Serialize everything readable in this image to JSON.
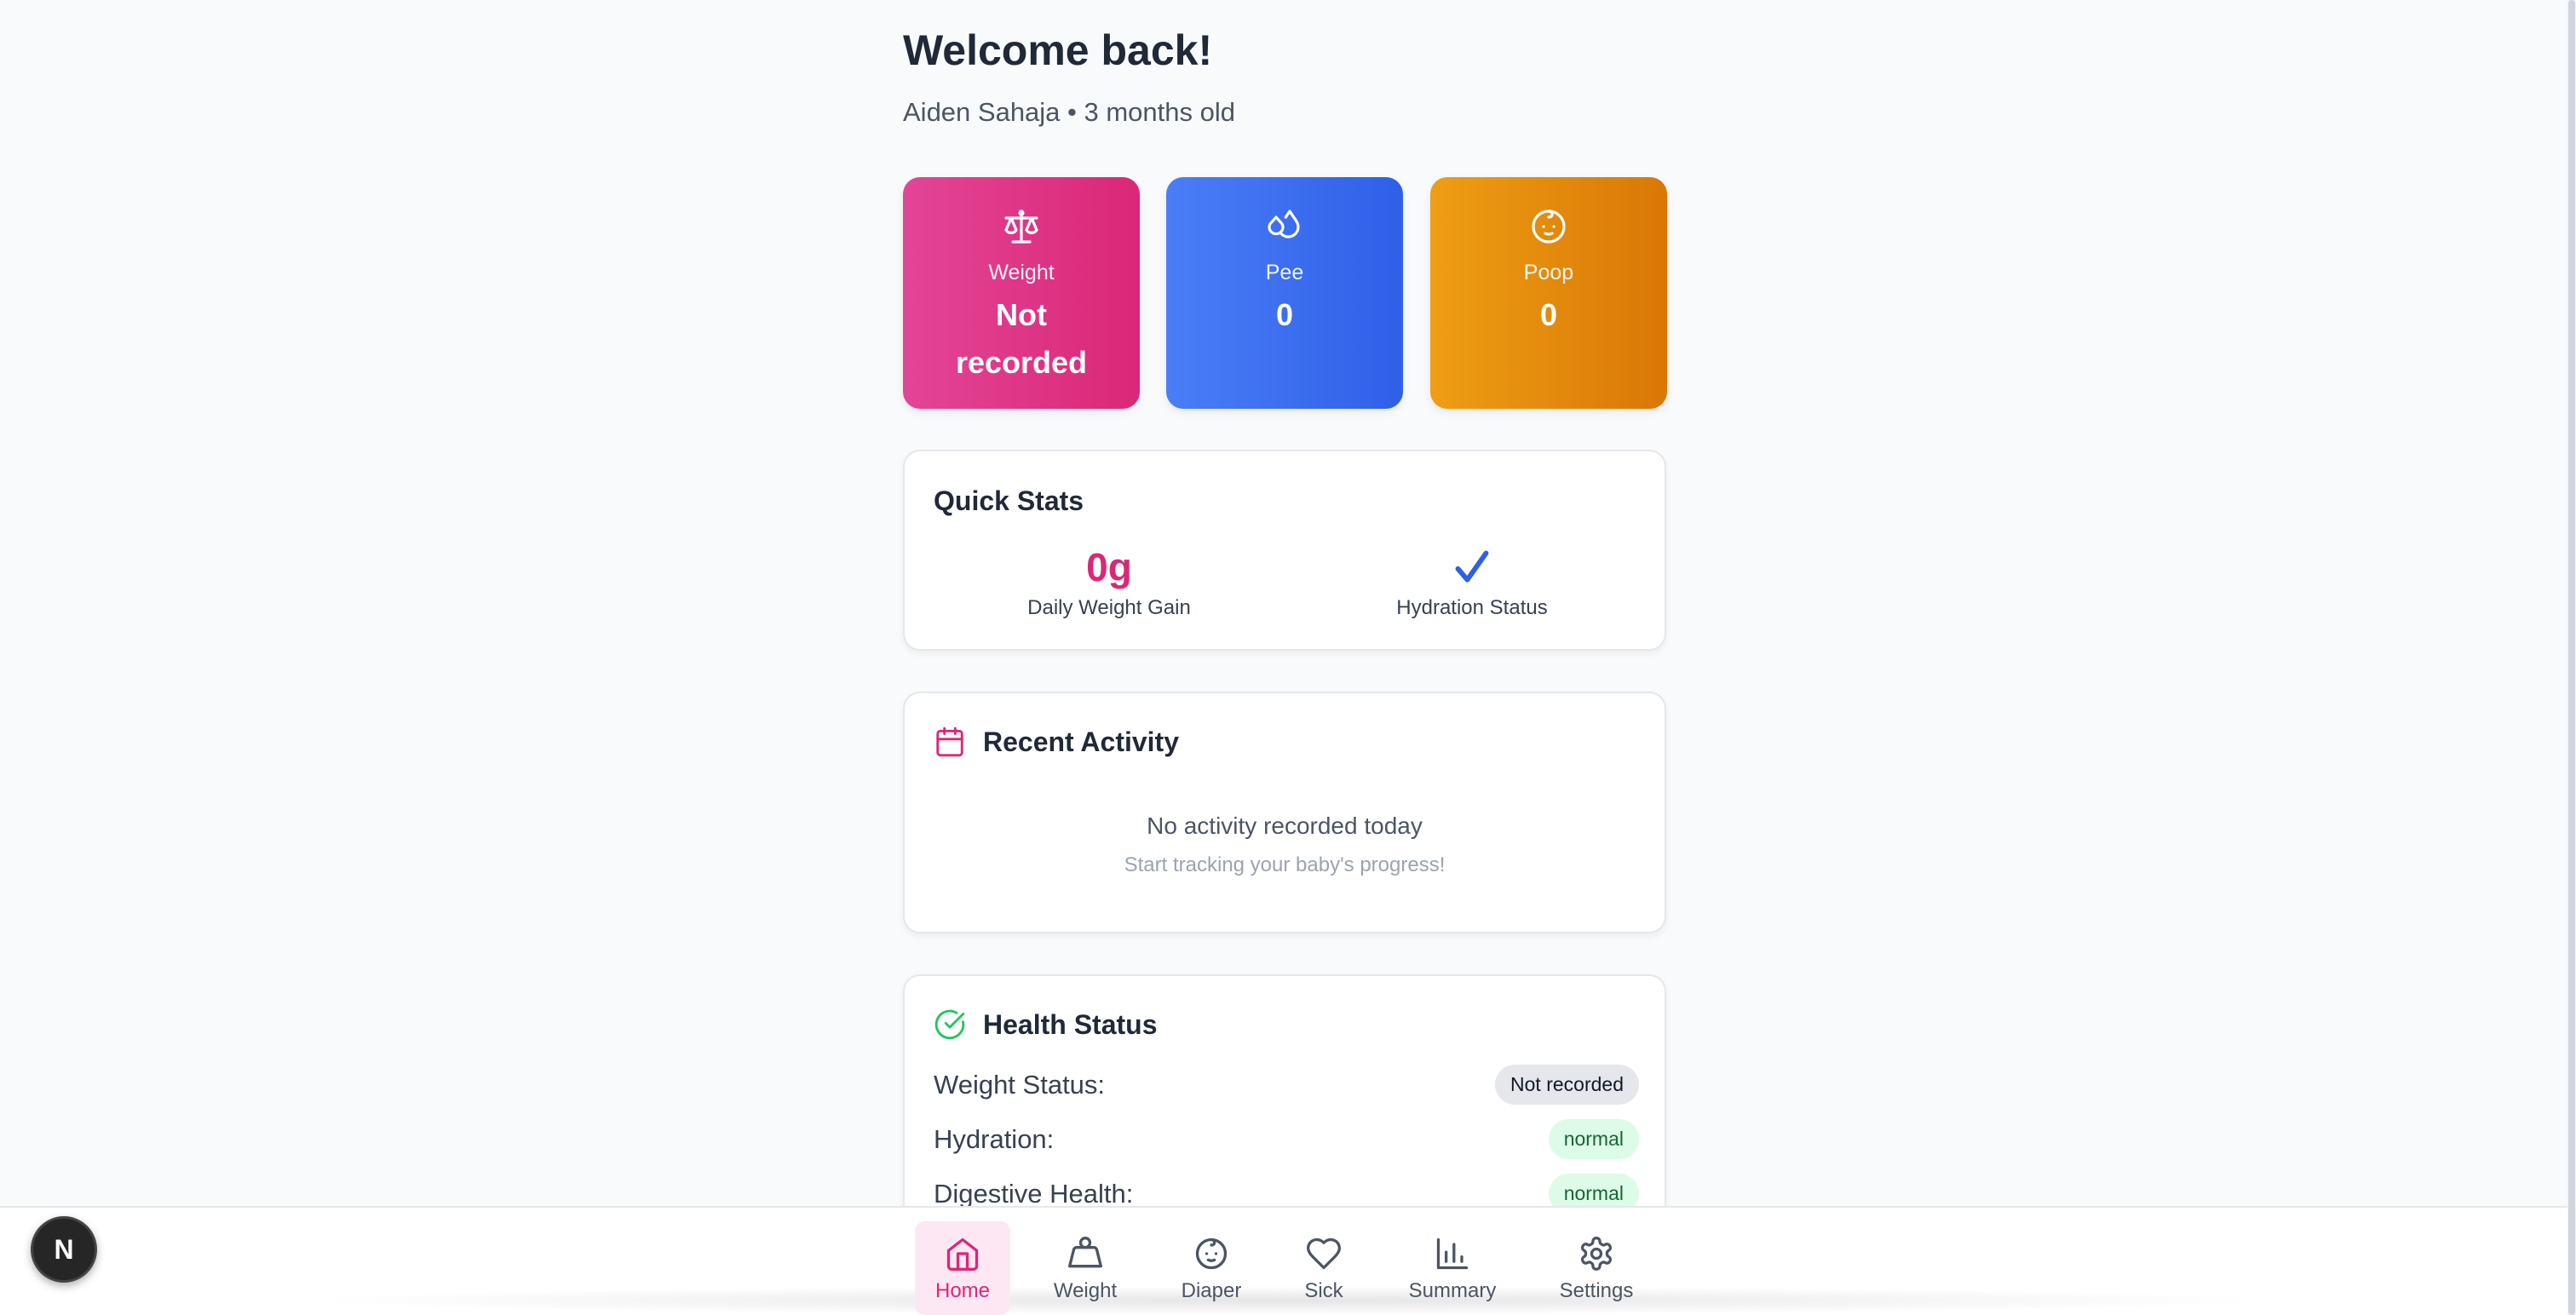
{
  "header": {
    "title": "Welcome back!",
    "subtitle": "Aiden Sahaja • 3 months old"
  },
  "tiles": [
    {
      "label": "Weight",
      "value": "Not recorded",
      "icon": "scale-icon",
      "color": "#db2777"
    },
    {
      "label": "Pee",
      "value": "0",
      "icon": "droplets-icon",
      "color": "#2f5fe8"
    },
    {
      "label": "Poop",
      "value": "0",
      "icon": "baby-icon",
      "color": "#d97706"
    }
  ],
  "quick_stats": {
    "title": "Quick Stats",
    "daily_weight_gain_value": "0g",
    "daily_weight_gain_label": "Daily Weight Gain",
    "hydration_label": "Hydration Status",
    "hydration_icon": "check-icon"
  },
  "recent_activity": {
    "title": "Recent Activity",
    "icon": "calendar-icon",
    "empty_title": "No activity recorded today",
    "empty_subtitle": "Start tracking your baby's progress!"
  },
  "health_status": {
    "title": "Health Status",
    "icon": "circle-check-icon",
    "rows": [
      {
        "label": "Weight Status:",
        "status": "Not recorded",
        "tone": "gray"
      },
      {
        "label": "Hydration:",
        "status": "normal",
        "tone": "green"
      },
      {
        "label": "Digestive Health:",
        "status": "normal",
        "tone": "green"
      }
    ]
  },
  "nav": {
    "items": [
      {
        "label": "Home",
        "icon": "home-icon",
        "active": true
      },
      {
        "label": "Weight",
        "icon": "weight-icon",
        "active": false
      },
      {
        "label": "Diaper",
        "icon": "baby-icon",
        "active": false
      },
      {
        "label": "Sick",
        "icon": "heart-icon",
        "active": false
      },
      {
        "label": "Summary",
        "icon": "bar-chart-icon",
        "active": false
      },
      {
        "label": "Settings",
        "icon": "gear-icon",
        "active": false
      }
    ]
  },
  "dev_badge": {
    "label": "N"
  },
  "colors": {
    "accent": "#db2777",
    "background": "#f8fafc",
    "success": "#22c55e"
  }
}
